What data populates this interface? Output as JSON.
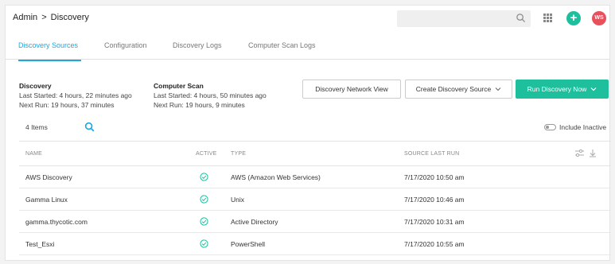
{
  "header": {
    "breadcrumb": [
      "Admin",
      ">",
      "Discovery"
    ],
    "add_icon": "plus-icon",
    "avatar_initials": "WS",
    "colors": {
      "accent": "#1ea7e1",
      "primary": "#1ebf9c",
      "avatar": "#e8505b"
    }
  },
  "tabs": [
    {
      "label": "Discovery Sources"
    },
    {
      "label": "Configuration"
    },
    {
      "label": "Discovery Logs"
    },
    {
      "label": "Computer Scan Logs"
    }
  ],
  "discovery": {
    "title": "Discovery",
    "last_started": "Last Started: 4 hours, 22 minutes ago",
    "next_run": "Next Run: 19 hours, 37 minutes"
  },
  "computer_scan": {
    "title": "Computer Scan",
    "last_started": "Last Started: 4 hours, 50 minutes ago",
    "next_run": "Next Run: 19 hours, 9 minutes"
  },
  "actions": {
    "network_view": "Discovery Network View",
    "create_source": "Create Discovery Source",
    "run_now": "Run Discovery Now"
  },
  "list": {
    "count_label": "4 Items",
    "include_inactive": "Include Inactive"
  },
  "table": {
    "columns": [
      "NAME",
      "ACTIVE",
      "TYPE",
      "SOURCE LAST RUN"
    ],
    "rows": [
      {
        "name": "AWS Discovery",
        "type": "AWS (Amazon Web Services)",
        "last_run": "7/17/2020 10:50 am"
      },
      {
        "name": "Gamma Linux",
        "type": "Unix",
        "last_run": "7/17/2020 10:46 am"
      },
      {
        "name": "gamma.thycotic.com",
        "type": "Active Directory",
        "last_run": "7/17/2020 10:31 am"
      },
      {
        "name": "Test_Esxi",
        "type": "PowerShell",
        "last_run": "7/17/2020 10:55 am"
      }
    ]
  }
}
